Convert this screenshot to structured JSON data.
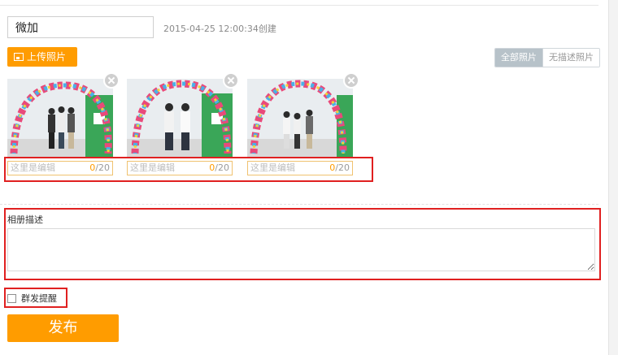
{
  "album": {
    "name": "微加",
    "created": "2015-04-25 12:00:34创建"
  },
  "toolbar": {
    "upload_label": "上传照片"
  },
  "filter": {
    "all_label": "全部照片",
    "undescribed_label": "无描述照片",
    "active": "all"
  },
  "photos": [
    {
      "caption_placeholder": "这里是编辑",
      "count": "0",
      "limit": "/20"
    },
    {
      "caption_placeholder": "这里是编辑",
      "count": "0",
      "limit": "/20"
    },
    {
      "caption_placeholder": "这里是编辑",
      "count": "0",
      "limit": "/20"
    }
  ],
  "description": {
    "label": "相册描述",
    "value": ""
  },
  "remind": {
    "label": "群发提醒",
    "checked": false
  },
  "publish": {
    "label": "发布"
  },
  "colors": {
    "accent": "#ff9c00",
    "highlight_border": "#e02020",
    "caption_border": "#f0c270",
    "filter_active": "#b7c2c9"
  }
}
